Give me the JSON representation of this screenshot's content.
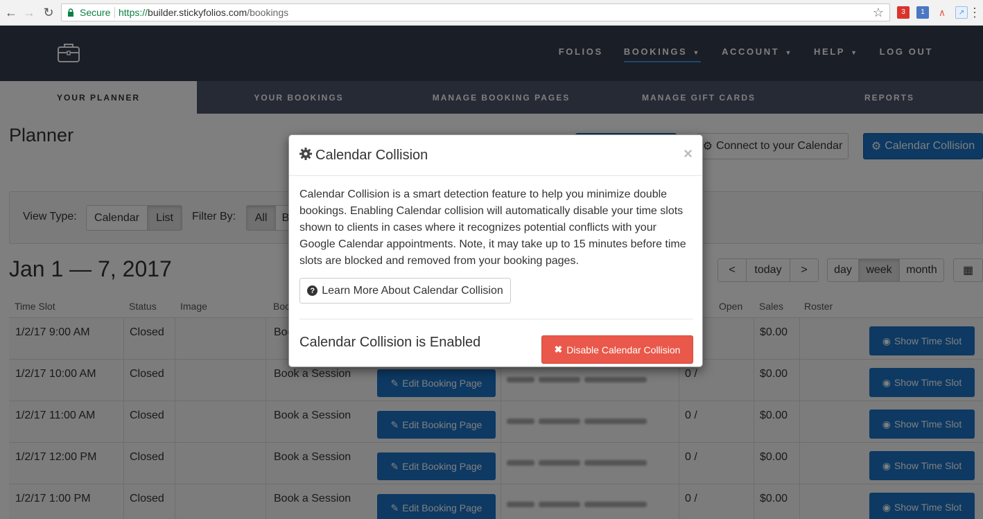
{
  "browser": {
    "secure_label": "Secure",
    "url_scheme": "https://",
    "url_host": "builder.stickyfolios.com",
    "url_path": "/bookings",
    "ext_badge_1": "3",
    "ext_badge_2": "1"
  },
  "header": {
    "nav": [
      {
        "label": "FOLIOS"
      },
      {
        "label": "BOOKINGS"
      },
      {
        "label": "ACCOUNT"
      },
      {
        "label": "HELP"
      },
      {
        "label": "LOG OUT"
      }
    ]
  },
  "subnav": [
    {
      "label": "YOUR PLANNER"
    },
    {
      "label": "YOUR BOOKINGS"
    },
    {
      "label": "MANAGE BOOKING PAGES"
    },
    {
      "label": "MANAGE GIFT CARDS"
    },
    {
      "label": "REPORTS"
    }
  ],
  "page": {
    "title": "Planner",
    "connect_label": "Connect to your Calendar",
    "collision_label": "Calendar Collision",
    "view_type_label": "View Type:",
    "view_calendar": "Calendar",
    "view_list": "List",
    "filter_label": "Filter By:",
    "filter_all": "All",
    "filter_b": "B",
    "date_range": "Jan 1 — 7, 2017",
    "prev": "<",
    "today": "today",
    "next": ">",
    "day": "day",
    "week": "week",
    "month": "month"
  },
  "table": {
    "headers": [
      "Time Slot",
      "Status",
      "Image",
      "Boo",
      "Open",
      "Sales",
      "Roster"
    ],
    "edit_label": "Edit Booking Page",
    "show_label": "Show Time Slot",
    "rows": [
      {
        "time": "1/2/17 9:00 AM",
        "status": "Closed",
        "page": "Boo",
        "open": "",
        "sales": "$0.00"
      },
      {
        "time": "1/2/17 10:00 AM",
        "status": "Closed",
        "page": "Book a Session",
        "open": "0 /",
        "sales": "$0.00"
      },
      {
        "time": "1/2/17 11:00 AM",
        "status": "Closed",
        "page": "Book a Session",
        "open": "0 /",
        "sales": "$0.00"
      },
      {
        "time": "1/2/17 12:00 PM",
        "status": "Closed",
        "page": "Book a Session",
        "open": "0 /",
        "sales": "$0.00"
      },
      {
        "time": "1/2/17 1:00 PM",
        "status": "Closed",
        "page": "Book a Session",
        "open": "0 /",
        "sales": "$0.00"
      }
    ]
  },
  "modal": {
    "title": "Calendar Collision",
    "close": "×",
    "body": "Calendar Collision is a smart detection feature to help you minimize double bookings. Enabling Calendar collision will automatically disable your time slots shown to clients in cases where it recognizes potential conflicts with your Google Calendar appointments. Note, it may take up to 15 minutes before time slots are blocked and removed from your booking pages.",
    "learn_more": "Learn More About Calendar Collision",
    "status": "Calendar Collision is Enabled",
    "disable_label": "Disable Calendar Collision"
  },
  "colors": {
    "header_bg": "#353d4d",
    "subnav_bg": "#4d5468",
    "primary": "#1a73c7",
    "danger": "#e9584a",
    "accent_underline": "#3a8ee6"
  }
}
